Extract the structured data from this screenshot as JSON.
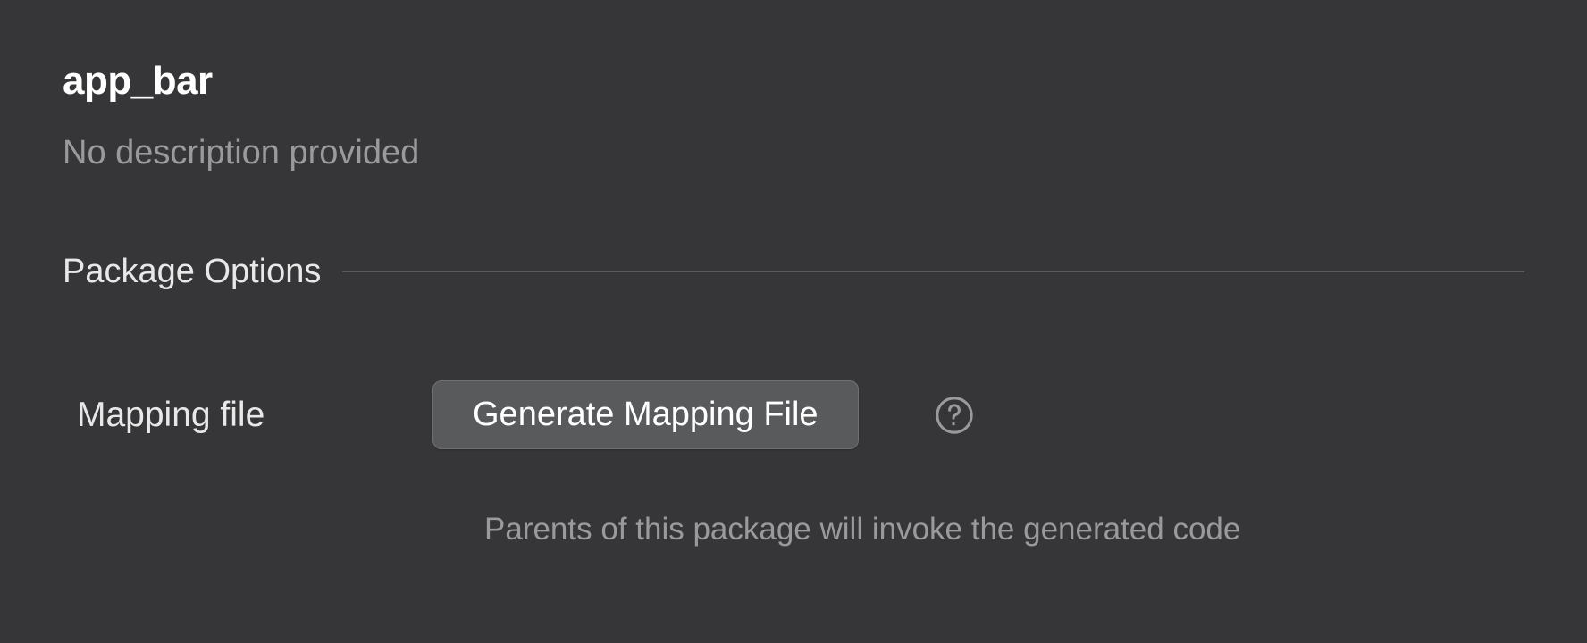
{
  "header": {
    "title": "app_bar",
    "description": "No description provided"
  },
  "section": {
    "title": "Package Options"
  },
  "options": {
    "mapping_file": {
      "label": "Mapping file",
      "button_label": "Generate Mapping File",
      "hint": "Parents of this package will invoke the generated code"
    }
  },
  "colors": {
    "background": "#363638",
    "text_primary": "#e8e8e8",
    "text_muted": "#9a9a9c",
    "button_bg": "#595a5c"
  }
}
